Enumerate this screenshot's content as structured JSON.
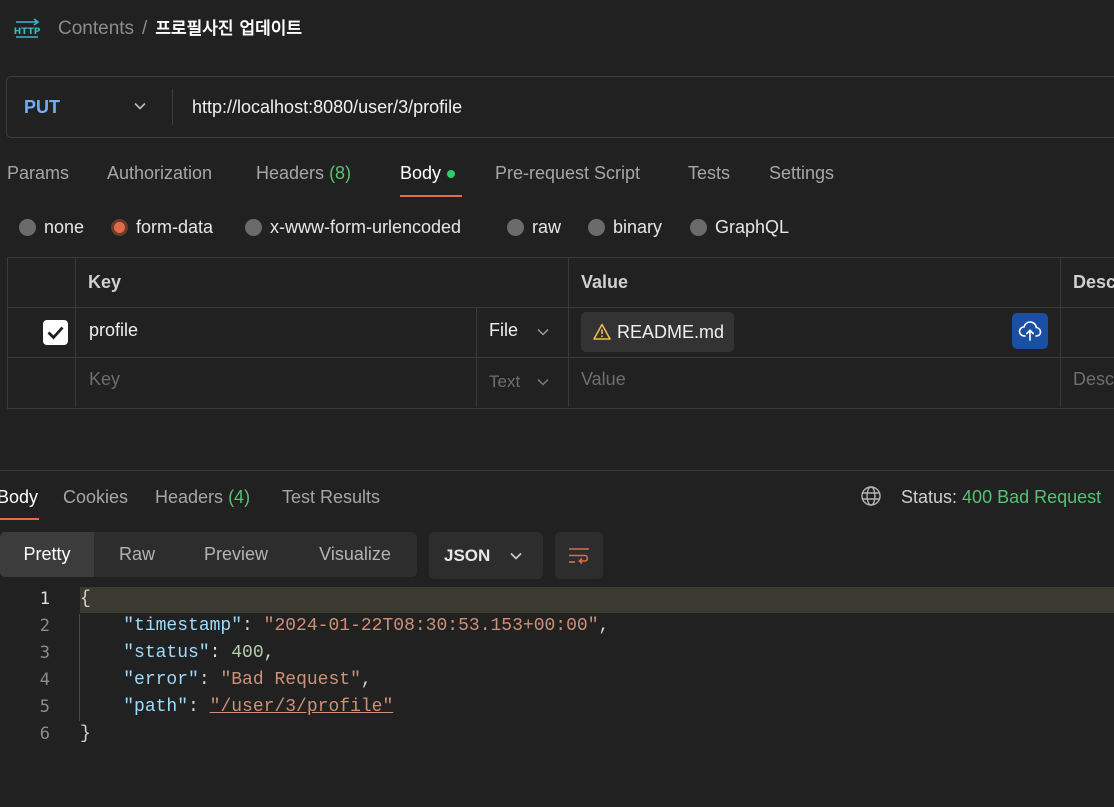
{
  "header": {
    "breadcrumb_root": "Contents",
    "breadcrumb_sep": "/",
    "title": "프로필사진 업데이트",
    "icon": "http-icon"
  },
  "request": {
    "method": "PUT",
    "url": "http://localhost:8080/user/3/profile"
  },
  "request_tabs": {
    "params": "Params",
    "authorization": "Authorization",
    "headers": "Headers",
    "headers_count": "(8)",
    "body": "Body",
    "prerequest": "Pre-request Script",
    "tests": "Tests",
    "settings": "Settings"
  },
  "body_types": {
    "none": "none",
    "form_data": "form-data",
    "urlencoded": "x-www-form-urlencoded",
    "raw": "raw",
    "binary": "binary",
    "graphql": "GraphQL",
    "selected": "form-data"
  },
  "form_table": {
    "headers": {
      "key": "Key",
      "value": "Value",
      "description": "Desc"
    },
    "rows": [
      {
        "checked": true,
        "key": "profile",
        "type": "File",
        "value": "README.md"
      }
    ],
    "new_row": {
      "key_placeholder": "Key",
      "type": "Text",
      "value_placeholder": "Value",
      "desc_placeholder": "Desc"
    }
  },
  "response_tabs": {
    "body": "Body",
    "cookies": "Cookies",
    "headers": "Headers",
    "headers_count": "(4)",
    "test_results": "Test Results"
  },
  "status": {
    "label": "Status:",
    "value": "400 Bad Request"
  },
  "view_modes": {
    "pretty": "Pretty",
    "raw": "Raw",
    "preview": "Preview",
    "visualize": "Visualize",
    "format": "JSON"
  },
  "response_body": {
    "line_numbers": [
      "1",
      "2",
      "3",
      "4",
      "5",
      "6"
    ],
    "open_brace": "{",
    "close_brace": "}",
    "fields": [
      {
        "key": "\"timestamp\"",
        "value": "\"2024-01-22T08:30:53.153+00:00\""
      },
      {
        "key": "\"status\"",
        "value": "400"
      },
      {
        "key": "\"error\"",
        "value": "\"Bad Request\""
      },
      {
        "key": "\"path\"",
        "value": "\"/user/3/profile\""
      }
    ]
  },
  "colors": {
    "background": "#212121",
    "accent": "#e06c48",
    "method": "#74aef6",
    "success_green": "#56c274"
  }
}
